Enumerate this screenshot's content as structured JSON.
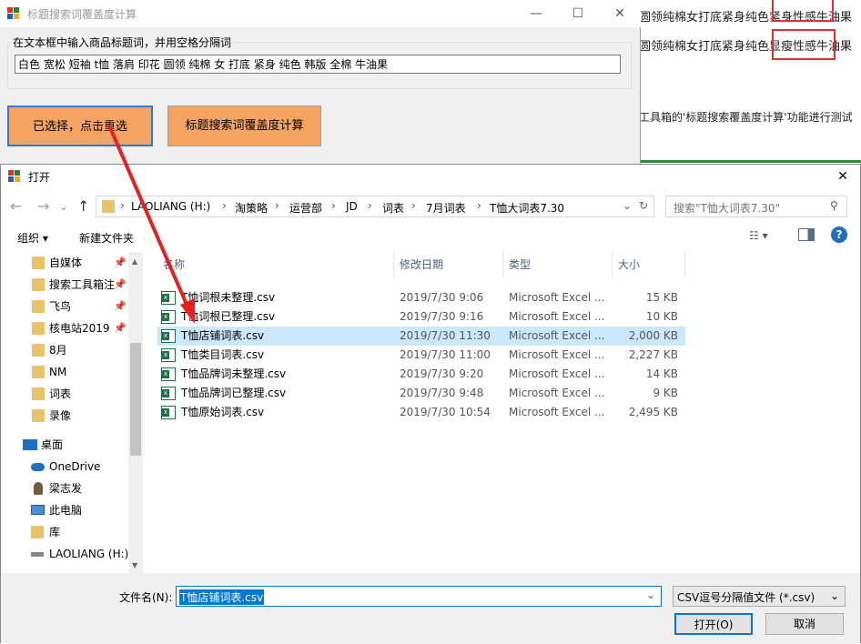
{
  "background_doc": {
    "line1": "圆领纯棉女打底紧身纯色紧身性感牛油果",
    "line2": "圆领纯棉女打底紧身纯色显瘦性感牛油果",
    "line3": "工具箱的'标题搜索覆盖度计算'功能进行测试"
  },
  "calc_window": {
    "title": "标题搜索词覆盖度计算",
    "minimize": "—",
    "maximize": "☐",
    "close": "✕",
    "group_label": "在文本框中输入商品标题词，并用空格分隔词",
    "keywords_value": "白色 宽松 短袖 t恤 落肩 印花 圆领 纯棉 女 打底 紧身 纯色 韩版 全棉 牛油果",
    "reselect_button": "已选择，点击重选",
    "calc_button": "标题搜索词覆盖度计算"
  },
  "open_dialog": {
    "title": "打开",
    "close": "✕",
    "nav": {
      "back": "←",
      "forward": "→",
      "dropdown": "⌄",
      "up": "↑"
    },
    "breadcrumb": [
      "LAOLIANG (H:)",
      "淘策略",
      "运营部",
      "JD",
      "词表",
      "7月词表",
      "T恤大词表7.30"
    ],
    "search_placeholder": "搜索\"T恤大词表7.30\"",
    "toolbar": {
      "organize": "组织 ▾",
      "new_folder": "新建文件夹"
    },
    "nav_items": [
      {
        "label": "自媒体",
        "pinned": true
      },
      {
        "label": "搜索工具箱注",
        "pinned": true
      },
      {
        "label": "飞鸟",
        "pinned": true
      },
      {
        "label": "核电站2019",
        "pinned": true
      },
      {
        "label": "8月",
        "pinned": false
      },
      {
        "label": "NM",
        "pinned": false
      },
      {
        "label": "词表",
        "pinned": false
      },
      {
        "label": "录像",
        "pinned": false
      },
      {
        "label": "桌面",
        "pinned": false
      },
      {
        "label": "OneDrive",
        "pinned": false
      },
      {
        "label": "梁志发",
        "pinned": false
      },
      {
        "label": "此电脑",
        "pinned": false
      },
      {
        "label": "库",
        "pinned": false
      },
      {
        "label": "LAOLIANG (H:)",
        "pinned": false
      }
    ],
    "columns": {
      "name": "名称",
      "date": "修改日期",
      "type": "类型",
      "size": "大小"
    },
    "files": [
      {
        "name": "T恤词根未整理.csv",
        "date": "2019/7/30 9:06",
        "type": "Microsoft Excel ...",
        "size": "15 KB"
      },
      {
        "name": "T恤词根已整理.csv",
        "date": "2019/7/30 9:16",
        "type": "Microsoft Excel ...",
        "size": "10 KB"
      },
      {
        "name": "T恤店铺词表.csv",
        "date": "2019/7/30 11:30",
        "type": "Microsoft Excel ...",
        "size": "2,000 KB"
      },
      {
        "name": "T恤类目词表.csv",
        "date": "2019/7/30 11:00",
        "type": "Microsoft Excel ...",
        "size": "2,227 KB"
      },
      {
        "name": "T恤品牌词未整理.csv",
        "date": "2019/7/30 9:20",
        "type": "Microsoft Excel ...",
        "size": "14 KB"
      },
      {
        "name": "T恤品牌词已整理.csv",
        "date": "2019/7/30 9:48",
        "type": "Microsoft Excel ...",
        "size": "9 KB"
      },
      {
        "name": "T恤原始词表.csv",
        "date": "2019/7/30 10:54",
        "type": "Microsoft Excel ...",
        "size": "2,495 KB"
      }
    ],
    "filename_label": "文件名(N):",
    "filename_value": "T恤店铺词表.csv",
    "filetype": "CSV逗号分隔值文件 (*.csv)",
    "open_button": "打开(O)",
    "cancel_button": "取消"
  },
  "colors": {
    "accent": "#0078d7",
    "orange_button": "#f4a460",
    "annotation_red": "#e03030"
  }
}
